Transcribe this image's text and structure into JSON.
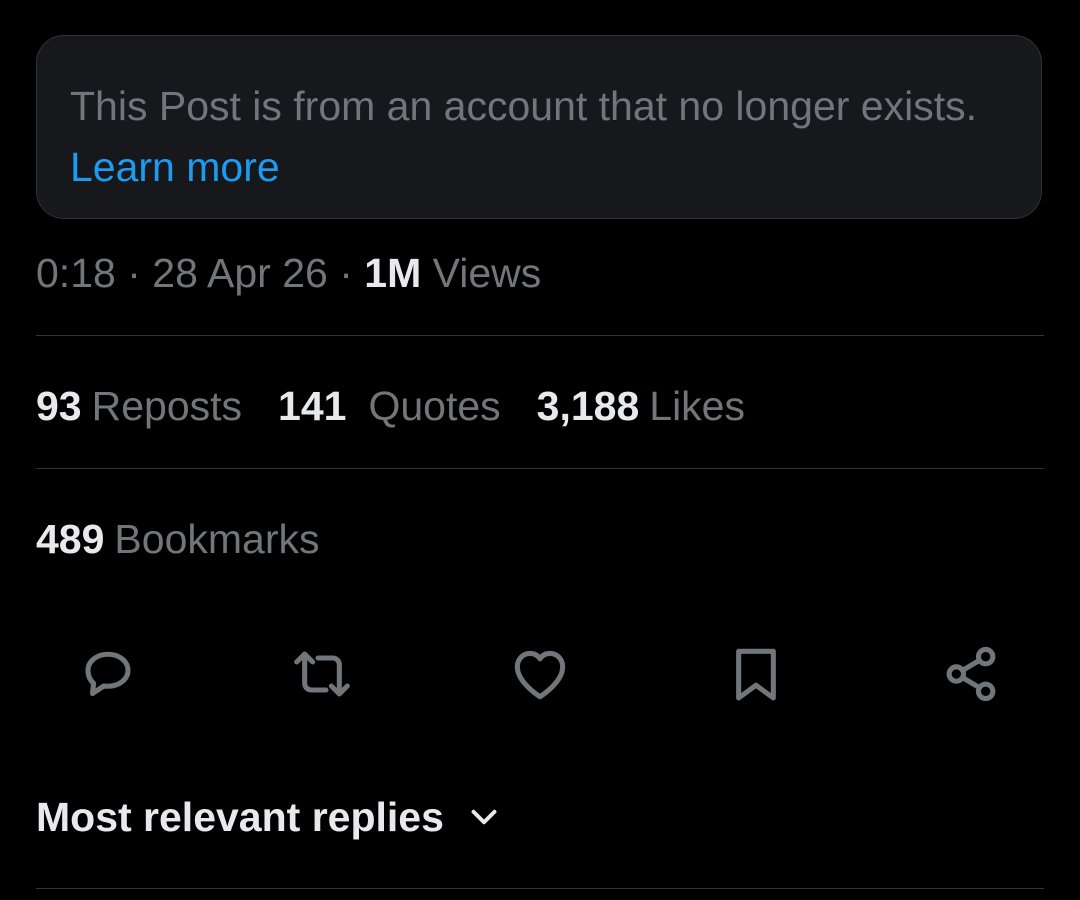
{
  "notice": {
    "text": "This Post is from an account that no longer exists.",
    "link_label": "Learn more"
  },
  "meta": {
    "time": "0:18",
    "separator": "·",
    "date": "28 Apr 26",
    "views_count": "1M",
    "views_label": "Views"
  },
  "stats": {
    "reposts": {
      "count": "93",
      "label": "Reposts"
    },
    "quotes": {
      "count": "141",
      "label": "Quotes"
    },
    "likes": {
      "count": "3,188",
      "label": "Likes"
    },
    "bookmarks": {
      "count": "489",
      "label": "Bookmarks"
    }
  },
  "actions": [
    {
      "icon": "reply-icon"
    },
    {
      "icon": "repost-icon"
    },
    {
      "icon": "like-icon"
    },
    {
      "icon": "bookmark-icon"
    },
    {
      "icon": "share-icon"
    }
  ],
  "replies_sort": {
    "label": "Most relevant replies",
    "icon": "chevron-down-icon"
  },
  "colors": {
    "background": "#000000",
    "card": "#16181c",
    "border": "#2f3336",
    "text_primary": "#e7e9ea",
    "text_secondary": "#71767b",
    "link": "#1d9bf0"
  }
}
